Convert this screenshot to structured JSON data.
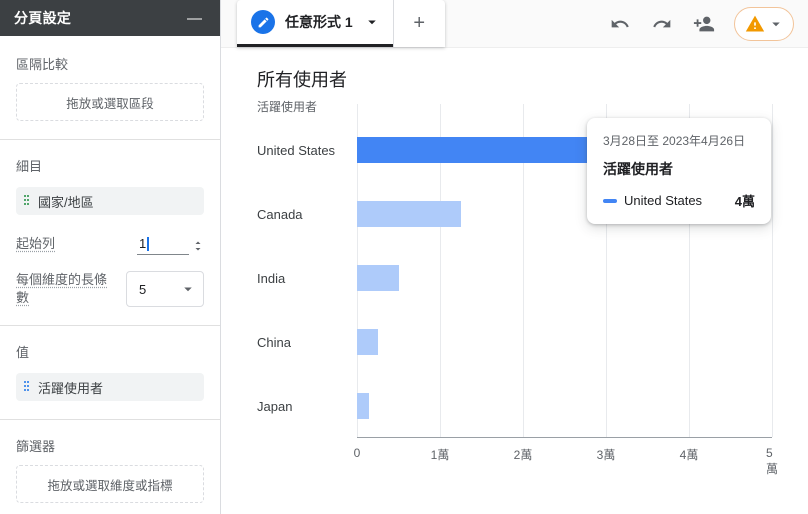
{
  "colors": {
    "accent": "#1a73e8",
    "bar": "#aecbfa",
    "bar_active": "#4285f4",
    "warning": "#f29900",
    "dimension_green": "#1e8e3e",
    "metric_blue": "#1a73e8"
  },
  "glyphs": {
    "minus": "—",
    "plus": "+"
  },
  "sidebar": {
    "title": "分頁設定",
    "segment": {
      "label": "區隔比較",
      "dropzone": "拖放或選取區段"
    },
    "breakdown": {
      "label": "細目",
      "chip": "國家/地區"
    },
    "start_row": {
      "label": "起始列",
      "value": "1"
    },
    "bars_per_dimension": {
      "label": "每個維度的長條數",
      "value": "5"
    },
    "values": {
      "label": "值",
      "chip": "活躍使用者"
    },
    "filters": {
      "label": "篩選器",
      "dropzone": "拖放或選取維度或指標"
    }
  },
  "topbar": {
    "tab": {
      "label": "任意形式 1"
    }
  },
  "chart": {
    "title": "所有使用者",
    "metric_label": "活躍使用者"
  },
  "tooltip": {
    "date_range": "3月28日至 2023年4月26日",
    "metric": "活躍使用者",
    "series": "United States",
    "value": "4萬"
  },
  "chart_data": {
    "type": "bar",
    "orientation": "horizontal",
    "title": "所有使用者",
    "metric": "活躍使用者",
    "categories": [
      "United States",
      "Canada",
      "India",
      "China",
      "Japan"
    ],
    "values": [
      40000,
      12500,
      5000,
      2500,
      1500
    ],
    "active_index": 0,
    "xlim": [
      0,
      50000
    ],
    "tick_labels": [
      "0",
      "1萬",
      "2萬",
      "3萬",
      "4萬",
      "5萬"
    ],
    "grid": true,
    "legend_position": "tooltip"
  }
}
